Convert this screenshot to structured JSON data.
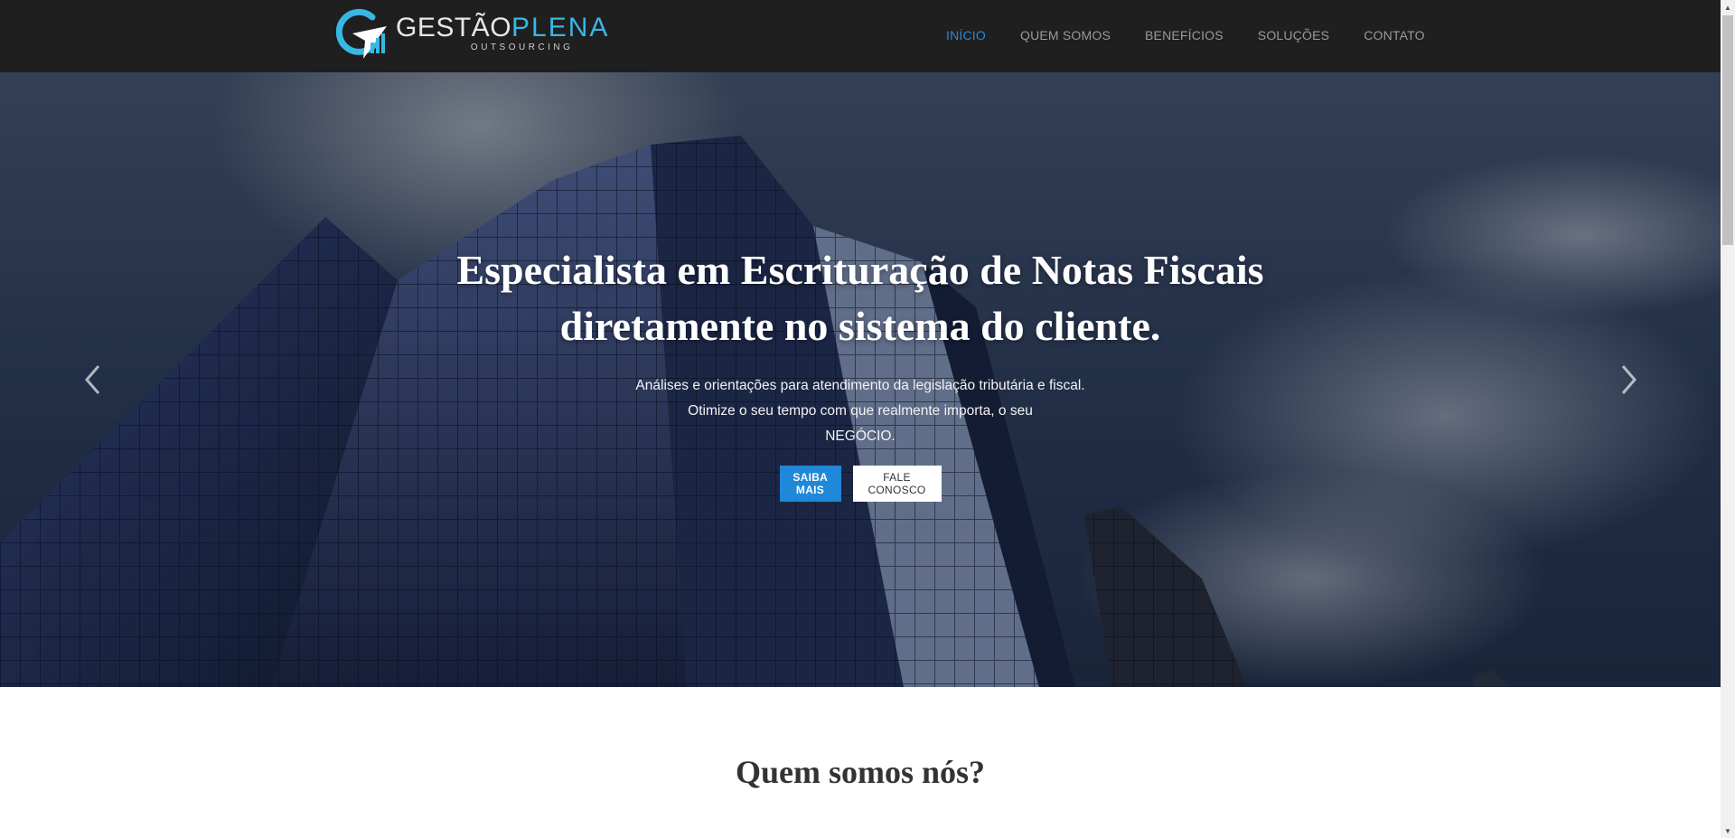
{
  "brand": {
    "name_part1": "GESTÃO",
    "name_part2": "PLENA",
    "tagline": "OUTSOURCING",
    "logo_icon": "gp-logo-mark"
  },
  "nav": {
    "items": [
      {
        "label": "INÍCIO",
        "active": true
      },
      {
        "label": "QUEM SOMOS",
        "active": false
      },
      {
        "label": "BENEFÍCIOS",
        "active": false
      },
      {
        "label": "SOLUÇÕES",
        "active": false
      },
      {
        "label": "CONTATO",
        "active": false
      }
    ]
  },
  "hero": {
    "title_line1": "Especialista em Escrituração de Notas Fiscais",
    "title_line2": "diretamente no sistema do cliente.",
    "text_line1": "Análises e orientações para atendimento da legislação tributária e fiscal.",
    "text_line2": "Otimize o seu tempo com que realmente importa, o seu",
    "text_line3": "NEGÓCIO.",
    "btn_primary": "SAIBA MAIS",
    "btn_secondary": "FALE CONOSCO",
    "prev_icon": "chevron-left-icon",
    "next_icon": "chevron-right-icon"
  },
  "about": {
    "title": "Quem somos nós?"
  },
  "colors": {
    "nav_bg": "#1f1f1f",
    "accent": "#1f88d8",
    "brand_cyan": "#38b7e6",
    "nav_text": "#9a9a9a"
  }
}
